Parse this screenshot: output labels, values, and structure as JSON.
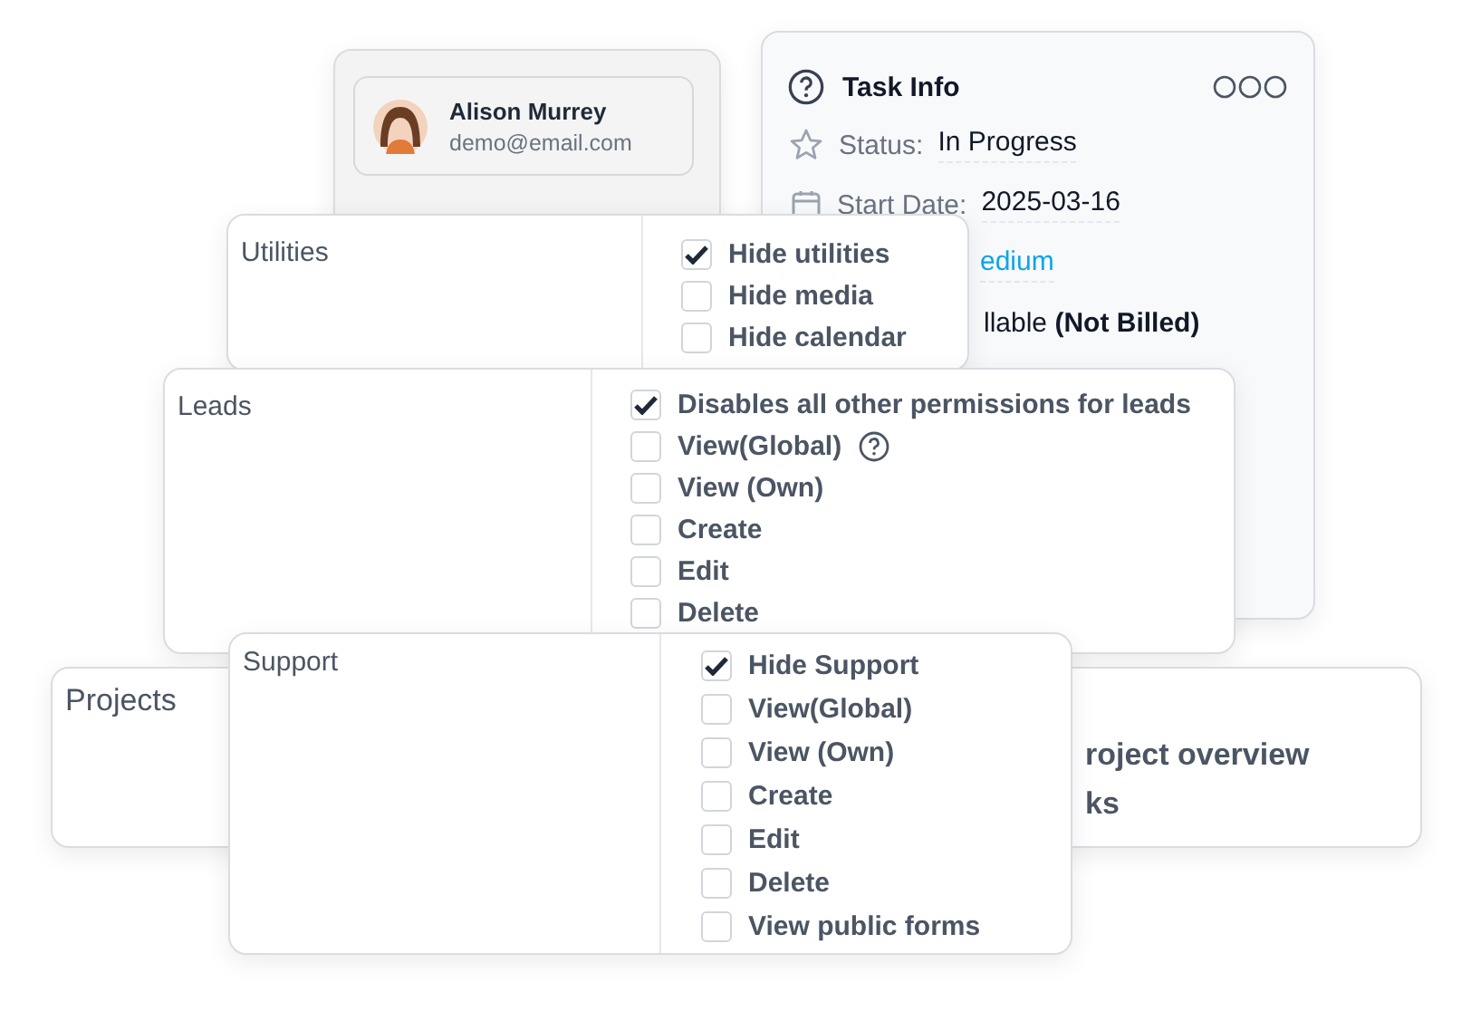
{
  "profile_card": {
    "name": "Alison Murrey",
    "email": "demo@email.com"
  },
  "task_info": {
    "title": "Task Info",
    "rows": [
      {
        "kind": "status",
        "label": "Status:",
        "value": "In Progress"
      },
      {
        "kind": "date",
        "label": "Start Date:",
        "value": "2025-03-16"
      },
      {
        "kind": "priority",
        "value": "edium"
      },
      {
        "kind": "billing",
        "value": "llable **(Not Billed)**"
      }
    ]
  },
  "permission_cards": [
    {
      "title": "Utilities",
      "options": [
        {
          "label": "Hide utilities",
          "checked": true,
          "help": false
        },
        {
          "label": "Hide media",
          "checked": false,
          "help": false
        },
        {
          "label": "Hide calendar",
          "checked": false,
          "help": false
        }
      ]
    },
    {
      "title": "Leads",
      "options": [
        {
          "label": "Disables all other permissions for leads",
          "checked": true,
          "help": false
        },
        {
          "label": "View(Global)",
          "checked": false,
          "help": true
        },
        {
          "label": "View (Own)",
          "checked": false,
          "help": false
        },
        {
          "label": "Create",
          "checked": false,
          "help": false
        },
        {
          "label": "Edit",
          "checked": false,
          "help": false
        },
        {
          "label": "Delete",
          "checked": false,
          "help": false
        }
      ]
    },
    {
      "title": "Support",
      "options": [
        {
          "label": "Hide Support",
          "checked": true,
          "help": false
        },
        {
          "label": "View(Global)",
          "checked": false,
          "help": false
        },
        {
          "label": "View (Own)",
          "checked": false,
          "help": false
        },
        {
          "label": "Create",
          "checked": false,
          "help": false
        },
        {
          "label": "Edit",
          "checked": false,
          "help": false
        },
        {
          "label": "Delete",
          "checked": false,
          "help": false
        },
        {
          "label": "View public forms",
          "checked": false,
          "help": false
        }
      ]
    }
  ],
  "projects_card": {
    "title": "Projects",
    "lines": [
      "roject overview",
      "ks"
    ]
  }
}
